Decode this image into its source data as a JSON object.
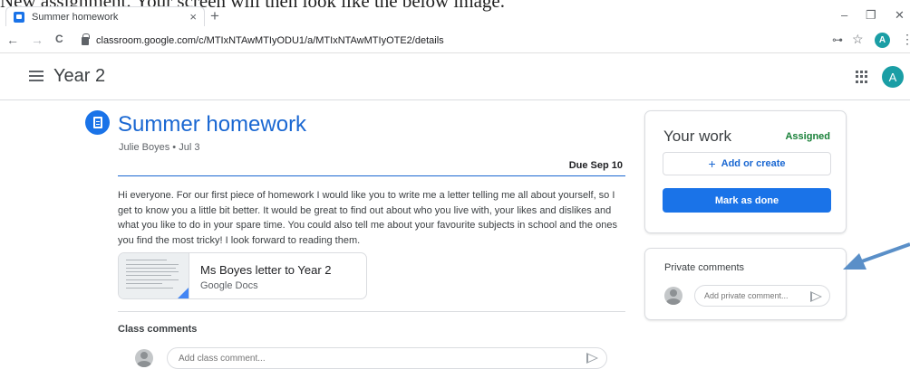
{
  "document": {
    "fragment_text": "New assignment. Your screen will then look like the below image."
  },
  "browser": {
    "tab_title": "Summer homework",
    "tab_close": "×",
    "new_tab": "+",
    "window_controls": {
      "minimize": "–",
      "restore": "❐",
      "close": "✕"
    },
    "nav": {
      "back": "←",
      "forward": "→",
      "reload": "C"
    },
    "url": "classroom.google.com/c/MTIxNTAwMTIyODU1/a/MTIxNTAwMTIyOTE2/details",
    "profile_initial": "A",
    "key_glyph": "⊶",
    "star_glyph": "☆",
    "menu_glyph": "⋮"
  },
  "app": {
    "class_name": "Year 2",
    "profile_initial": "A"
  },
  "assignment": {
    "title": "Summer homework",
    "meta": "Julie Boyes • Jul 3",
    "due": "Due Sep 10",
    "body": "Hi everyone. For our first piece of homework I would like you to write me a letter telling me all about yourself, so I get to know you a little bit better.  It would be great to find out about who you live with, your likes and dislikes and what you like to do in your spare time.  You could also tell me about your favourite subjects in school and the ones you find the most tricky!  I look forward to reading them.",
    "attachment": {
      "title": "Ms Boyes letter to Year 2",
      "type": "Google Docs"
    },
    "class_comments_label": "Class comments",
    "class_comment_placeholder": "Add class comment..."
  },
  "your_work": {
    "title": "Your work",
    "status": "Assigned",
    "add_create_label": "Add or create",
    "plus_glyph": "+",
    "mark_done_label": "Mark as done"
  },
  "private_comments": {
    "title": "Private comments",
    "placeholder": "Add private comment..."
  },
  "colors": {
    "brand_blue": "#1a73e8",
    "assigned_green": "#188038",
    "arrow_blue": "#5a8fc8"
  }
}
